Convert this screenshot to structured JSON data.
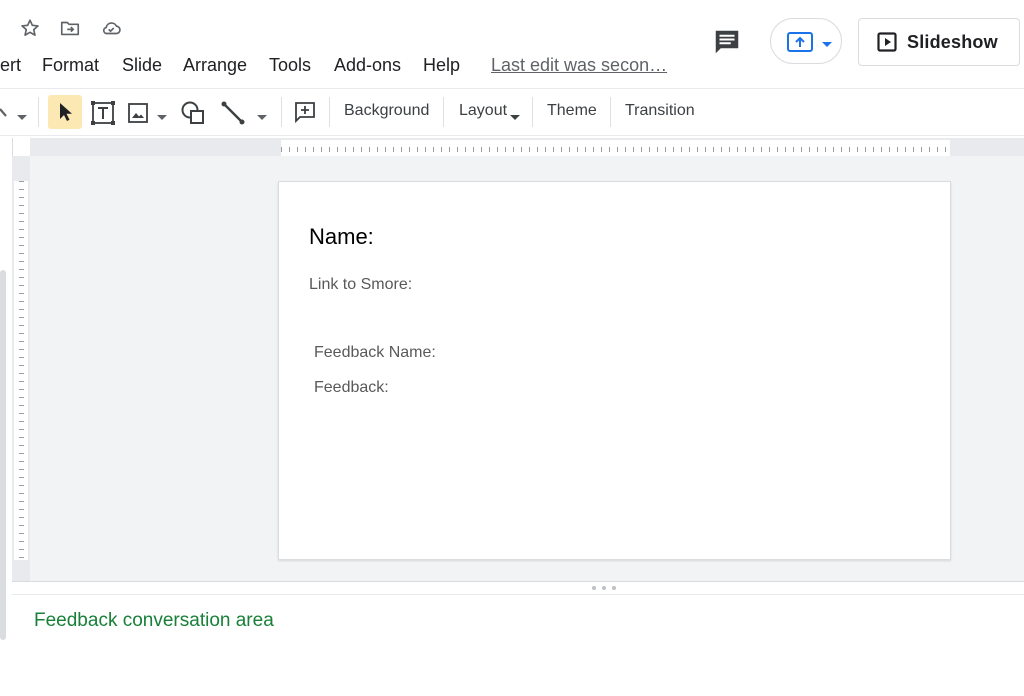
{
  "title_bar": {
    "star_icon": "star-icon",
    "move_icon": "folder-move-icon",
    "cloud_icon": "cloud-saved-icon"
  },
  "menu": {
    "items": [
      "ert",
      "Format",
      "Slide",
      "Arrange",
      "Tools",
      "Add-ons",
      "Help"
    ],
    "last_edit": "Last edit was secon…"
  },
  "header_right": {
    "comment_icon": "comment-icon",
    "present_icon": "present-icon",
    "slideshow_label": "Slideshow"
  },
  "toolbar": {
    "background_label": "Background",
    "layout_label": "Layout",
    "theme_label": "Theme",
    "transition_label": "Transition"
  },
  "slide": {
    "name_label": "Name:",
    "smore_label": "Link to Smore:",
    "feedback_name_label": "Feedback Name:",
    "feedback_label": "Feedback:"
  },
  "notes": {
    "text": "Feedback conversation area"
  },
  "colors": {
    "accent_blue": "#1a73e8",
    "notes_green": "#188038",
    "select_highlight": "#fce8b2"
  }
}
